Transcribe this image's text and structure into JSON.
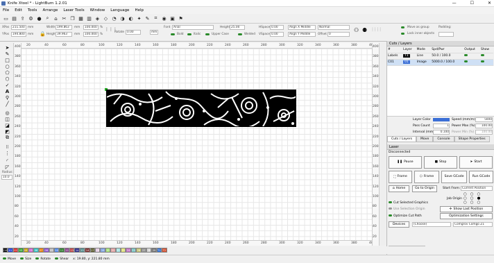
{
  "window": {
    "title": "Knife Xtool * - LightBurn 1.2.01",
    "min": "—",
    "max": "☐",
    "close": "✕"
  },
  "menu": [
    "File",
    "Edit",
    "Tools",
    "Arrange",
    "Laser Tools",
    "Window",
    "Language",
    "Help"
  ],
  "toolbar_icons": [
    "open-icon",
    "save-icon",
    "import-icon",
    "settings-icon",
    "circle-icon",
    "search-icon",
    "home-icon",
    "cut-icon",
    "copy-icon",
    "paste-icon",
    "delete-icon",
    "group-icon",
    "ungroup-icon",
    "weld-icon",
    "text-icon",
    "node-icon",
    "gear-icon",
    "wrench-icon",
    "trace-icon",
    "camera-icon",
    "frame-icon",
    "play-icon"
  ],
  "props": {
    "xpos_label": "XPos",
    "xpos": "211.500",
    "ypos_label": "YPos",
    "ypos": "194.800",
    "unit_mm": "mm",
    "width_label": "Width",
    "width": "199.863",
    "height_label": "Height",
    "height": "39.963",
    "pct1": "100.000",
    "pct2": "100.000",
    "pct_sign": "%",
    "rotate_label": "Rotate",
    "rotate": "0.00",
    "mm_btn": "mm",
    "font_label": "Font",
    "font": "Arial",
    "bold": "Bold",
    "italic": "Italic",
    "upper": "Upper Case",
    "theight_label": "Height",
    "theight": "25.00",
    "welded": "Welded",
    "hspace_label": "HSpace",
    "hspace": "0.00",
    "vspace_label": "VSpace",
    "vspace": "0.00",
    "alignx": "Align X Middle",
    "aligny": "Align Y Middle",
    "normal": "Normal",
    "offset_label": "Offset",
    "offset": "0"
  },
  "top_right": {
    "move_as_group": "Move as group",
    "lock_inner": "Lock inner objects",
    "padding": "Padding:"
  },
  "ruler_top": [
    "20",
    "40",
    "60",
    "80",
    "100",
    "120",
    "140",
    "160",
    "180",
    "200",
    "220",
    "240",
    "260",
    "280",
    "300",
    "320",
    "340",
    "360",
    "380",
    "400"
  ],
  "ruler_left": [
    "400",
    "380",
    "360",
    "340",
    "320",
    "300",
    "280",
    "260",
    "240",
    "220",
    "200",
    "180",
    "160",
    "140",
    "120",
    "100",
    "80",
    "60",
    "40",
    "20"
  ],
  "radius": {
    "label": "Radius:",
    "value": "10.0"
  },
  "cuts": {
    "title": "Cuts / Layers",
    "headers": [
      "#",
      "Layer",
      "Mode",
      "Spd/Pwr",
      "Output",
      "Show"
    ],
    "rows": [
      {
        "num": "Labels",
        "layer": "T1",
        "mode": "Line",
        "spd": "50.0 / 100.0",
        "color": "#111111"
      },
      {
        "num": "C01",
        "layer": "01",
        "mode": "Image",
        "spd": "5000.0 / 100.0",
        "color": "#3b6fd6"
      }
    ],
    "layer_color": "Layer Color",
    "speed_label": "Speed (mm/m)",
    "speed": "5000",
    "pass_label": "Pass Count",
    "pass": "1",
    "pmax_label": "Power Max (%)",
    "pmax": "100.00",
    "interval_label": "Interval (mm)",
    "interval": "0.100",
    "pmin_label": "Power Min (%)",
    "pmin": "100.00",
    "tabs": [
      "Cuts / Layers",
      "Move",
      "Console",
      "Shape Properties"
    ]
  },
  "laser": {
    "title": "Laser",
    "status": "Disconnected",
    "pause": "Pause",
    "stop": "Stop",
    "start": "Start",
    "frame1": "Frame",
    "frame2": "Frame",
    "save_gcode": "Save GCode",
    "run_gcode": "Run GCode",
    "home": "Home",
    "go_origin": "Go to Origin",
    "start_from_label": "Start From:",
    "start_from": "Current Position",
    "job_origin": "Job Origin",
    "cut_selected": "Cut Selected Graphics",
    "use_selection": "Use Selection Origin",
    "show_last": "Show Last Position",
    "optimize_cut": "Optimize Cut Path",
    "opt_settings": "Optimization Settings",
    "devices": "Devices",
    "device_sel": "(Choose)",
    "profile": "Comgrov Comgo Z1",
    "tabs": [
      "Laser",
      "Library"
    ]
  },
  "palette": [
    "00",
    "01",
    "02",
    "03",
    "04",
    "05",
    "06",
    "07",
    "08",
    "09",
    "10",
    "11",
    "12",
    "13",
    "14",
    "15",
    "16",
    "17",
    "18",
    "19",
    "20",
    "21",
    "22",
    "23",
    "24",
    "25",
    "26",
    "27",
    "28",
    "29",
    "T1",
    "T2"
  ],
  "palette_colors": [
    "#000000",
    "#1f3fd6",
    "#d81f1f",
    "#2aa02a",
    "#c9a000",
    "#d05cd0",
    "#2cc0c0",
    "#e87a00",
    "#8a4ad0",
    "#b5b5b5",
    "#4b86e8",
    "#2a7a2a",
    "#8a3a8a",
    "#c04040",
    "#2a2a8a",
    "#4a8a8a",
    "#7a2a2a",
    "#5a5a2a",
    "#e0c8e0",
    "#7aa0e0",
    "#a0e070",
    "#e0a0a0",
    "#a0e0e0",
    "#e0e070",
    "#c070c0",
    "#70c0c0",
    "#c0c070",
    "#909090",
    "#d0d0d0",
    "#707070",
    "#2a6ad0",
    "#d04a2a"
  ],
  "status": {
    "move": "Move",
    "size": "Size",
    "rotate": "Rotate",
    "shear": "Shear",
    "coords": "x: 19.80, y: 221.80 mm"
  }
}
